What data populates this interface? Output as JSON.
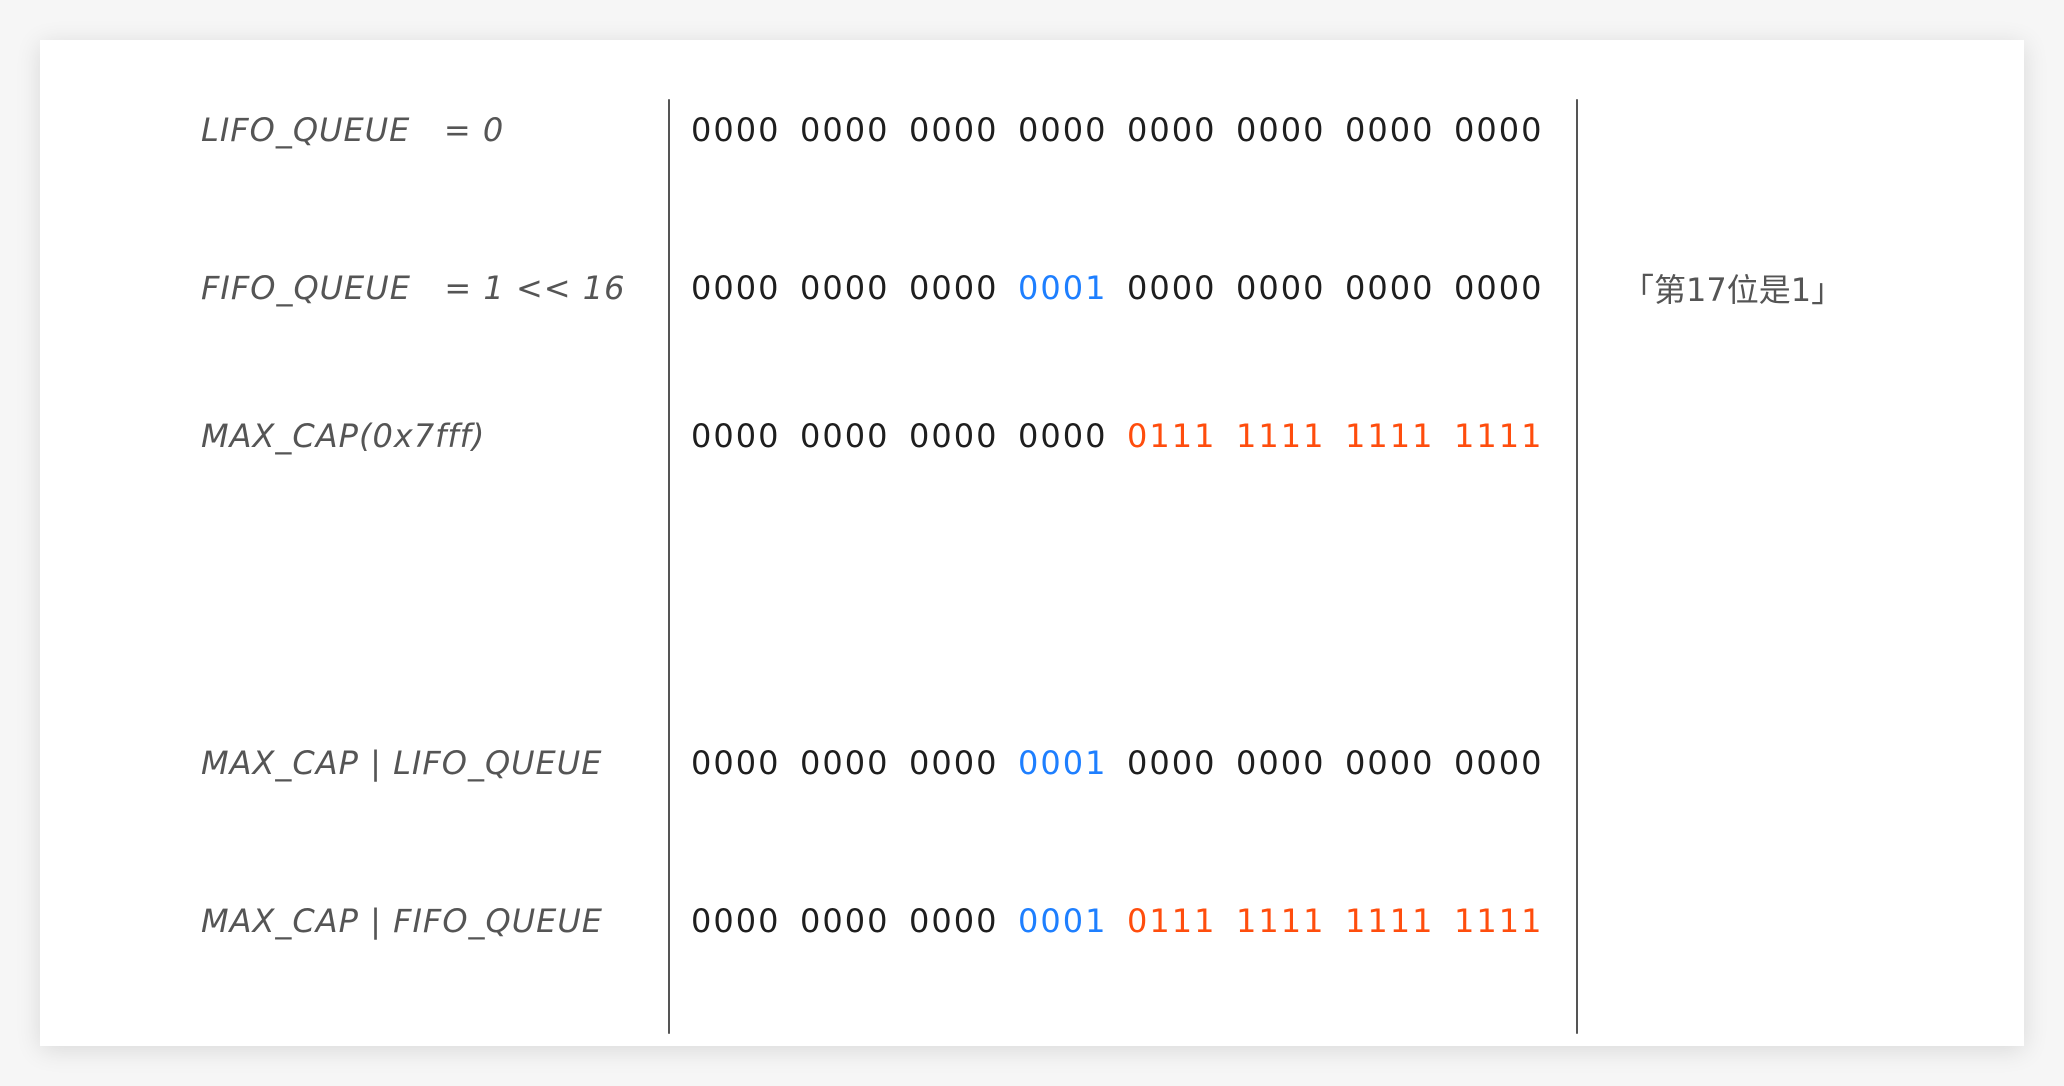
{
  "colors": {
    "default": "#1e1e1e",
    "blue": "#1e7fff",
    "orange": "#ff4d0d",
    "label": "#555555"
  },
  "rows": [
    {
      "label": "LIFO_QUEUE   = 0",
      "groups": [
        [
          "0000",
          "default"
        ],
        [
          "0000",
          "default"
        ],
        [
          "0000",
          "default"
        ],
        [
          "0000",
          "default"
        ],
        [
          "0000",
          "default"
        ],
        [
          "0000",
          "default"
        ],
        [
          "0000",
          "default"
        ],
        [
          "0000",
          "default"
        ]
      ]
    },
    {
      "label": "FIFO_QUEUE   = 1 << 16",
      "groups": [
        [
          "0000",
          "default"
        ],
        [
          "0000",
          "default"
        ],
        [
          "0000",
          "default"
        ],
        [
          "0001",
          "blue"
        ],
        [
          "0000",
          "default"
        ],
        [
          "0000",
          "default"
        ],
        [
          "0000",
          "default"
        ],
        [
          "0000",
          "default"
        ]
      ]
    },
    {
      "label": "MAX_CAP(0x7fff)",
      "groups": [
        [
          "0000",
          "default"
        ],
        [
          "0000",
          "default"
        ],
        [
          "0000",
          "default"
        ],
        [
          "0000",
          "default"
        ],
        [
          "0111",
          "orange"
        ],
        [
          "1111",
          "orange"
        ],
        [
          "1111",
          "orange"
        ],
        [
          "1111",
          "orange"
        ]
      ]
    },
    {
      "label": "MAX_CAP | LIFO_QUEUE",
      "groups": [
        [
          "0000",
          "default"
        ],
        [
          "0000",
          "default"
        ],
        [
          "0000",
          "default"
        ],
        [
          "0001",
          "blue"
        ],
        [
          "0000",
          "default"
        ],
        [
          "0000",
          "default"
        ],
        [
          "0000",
          "default"
        ],
        [
          "0000",
          "default"
        ]
      ]
    },
    {
      "label": "MAX_CAP | FIFO_QUEUE",
      "groups": [
        [
          "0000",
          "default"
        ],
        [
          "0000",
          "default"
        ],
        [
          "0000",
          "default"
        ],
        [
          "0001",
          "blue"
        ],
        [
          "0111",
          "orange"
        ],
        [
          "1111",
          "orange"
        ],
        [
          "1111",
          "orange"
        ],
        [
          "1111",
          "orange"
        ]
      ]
    }
  ],
  "note": "「第17位是1」"
}
